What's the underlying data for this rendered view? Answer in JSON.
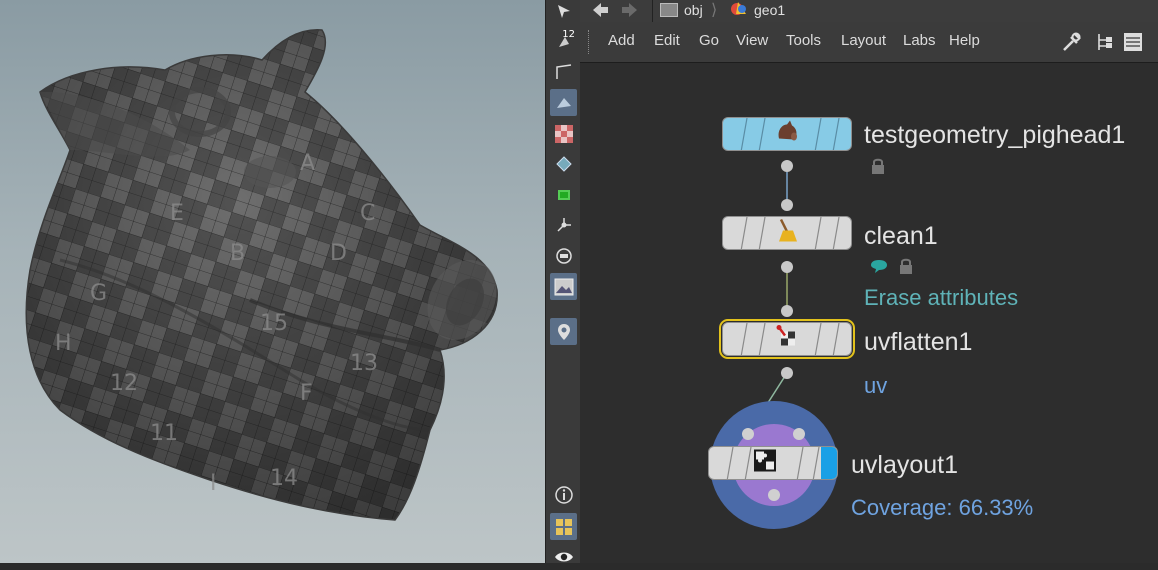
{
  "path_bar": {
    "back_icon": "arrow-left-icon",
    "forward_icon": "arrow-right-icon",
    "crumbs": [
      {
        "label": "obj",
        "icon": "network-icon"
      },
      {
        "label": "geo1",
        "icon": "geo-icon"
      }
    ]
  },
  "menubar": {
    "items": [
      "Add",
      "Edit",
      "Go",
      "View",
      "Tools",
      "Layout",
      "Labs",
      "Help"
    ],
    "right_icons": [
      "wrench-icon",
      "tree-icon",
      "list-icon"
    ]
  },
  "tool_strip": {
    "badge_number": "12",
    "icons": [
      "select-icon",
      "snap-icon",
      "polyline-icon",
      "shaded-icon",
      "checker-icon",
      "rotate-icon",
      "ground-icon",
      "handle-icon",
      "display-options-icon",
      "background-image-icon",
      "pin-icon",
      "info-icon",
      "layout-icon",
      "eye-icon"
    ]
  },
  "viewport": {
    "checker_letters": [
      "E",
      "D",
      "C",
      "B",
      "A",
      "G",
      "H",
      "I",
      "F",
      "14",
      "13",
      "12",
      "11",
      "15"
    ]
  },
  "network": {
    "nodes": [
      {
        "name": "testgeometry_pighead1",
        "info": "",
        "icon": "pig-head-icon"
      },
      {
        "name": "clean1",
        "info": "Erase attributes",
        "icon": "broom-icon"
      },
      {
        "name": "uvflatten1",
        "info": "uv",
        "icon": "uv-flatten-icon"
      },
      {
        "name": "uvlayout1",
        "info": "Coverage: 66.33%",
        "icon": "puzzle-icon"
      }
    ]
  },
  "colors": {
    "info_cyan": "#5fb3b8",
    "info_blue": "#6fa3e0",
    "node_blue": "#87cbe6",
    "selected_outline": "#e2c21c"
  }
}
